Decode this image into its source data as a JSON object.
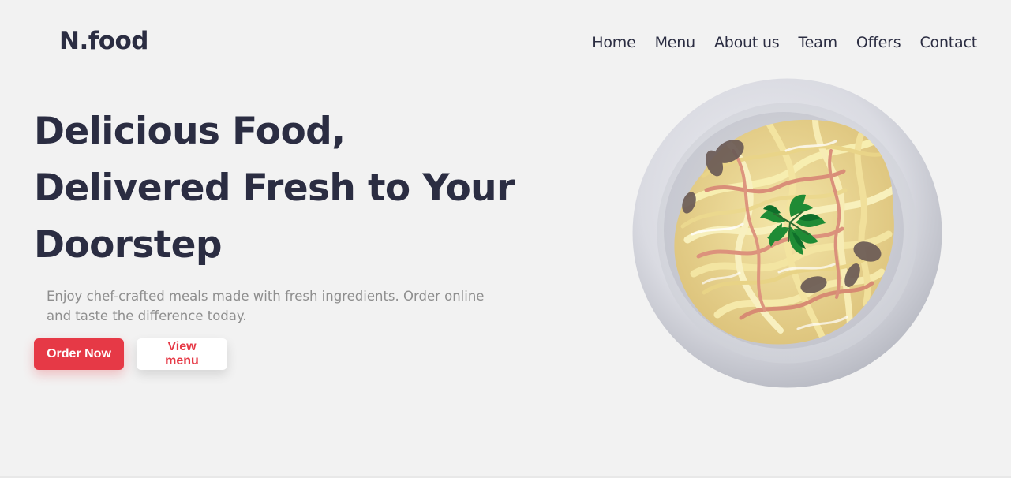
{
  "header": {
    "logo": "N.food",
    "nav": [
      "Home",
      "Menu",
      "About us",
      "Team",
      "Offers",
      "Contact"
    ]
  },
  "hero": {
    "title_lines": [
      "Delicious Food,",
      "Delivered Fresh to Your",
      "Doorstep"
    ],
    "subtitle": "Enjoy chef-crafted meals made with fresh ingredients. Order online and taste the difference today.",
    "primary_button": "Order Now",
    "secondary_button": "View menu"
  },
  "colors": {
    "background": "#f2f2f2",
    "text_dark": "#2b2d42",
    "accent": "#e63946",
    "muted_text": "#8e8e8e"
  },
  "icons": {
    "hero_image": "pasta-plate"
  }
}
